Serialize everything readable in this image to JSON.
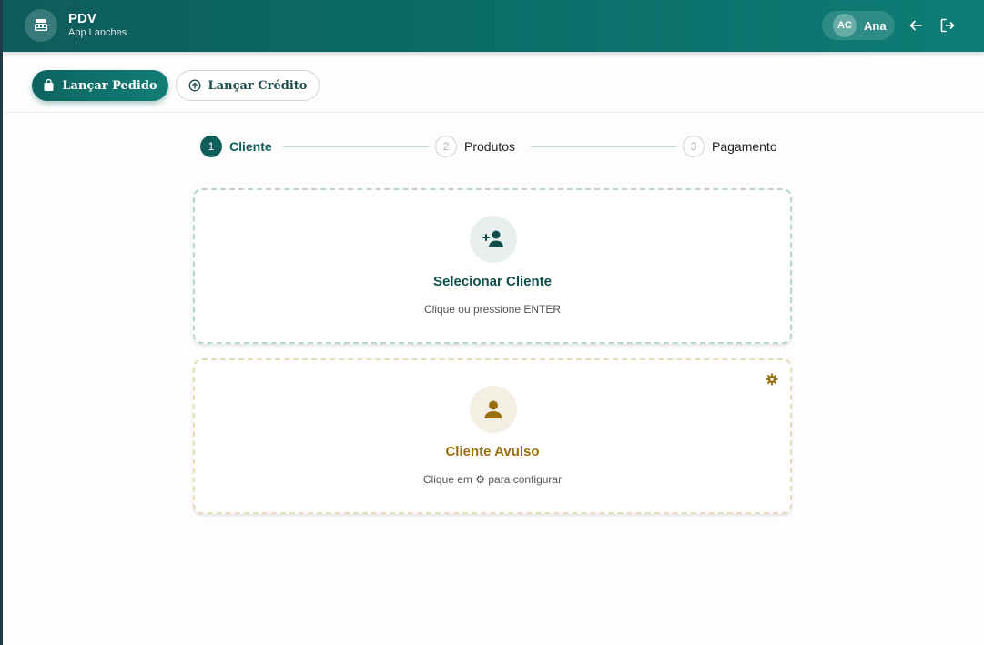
{
  "header": {
    "title": "PDV",
    "subtitle": "App Lanches",
    "user": {
      "initials": "AC",
      "name": "Ana"
    },
    "icons": {
      "logo": "cash-register-icon",
      "back": "arrow-left-icon",
      "logout": "logout-icon"
    }
  },
  "actions": {
    "primary_label": "Lançar Pedido",
    "secondary_label": "Lançar Crédito",
    "icons": {
      "primary": "shopping-bag-icon",
      "secondary": "circle-arrow-up-icon"
    }
  },
  "stepper": {
    "steps": [
      {
        "number": "1",
        "label": "Cliente",
        "active": true
      },
      {
        "number": "2",
        "label": "Produtos",
        "active": false
      },
      {
        "number": "3",
        "label": "Pagamento",
        "active": false
      }
    ]
  },
  "cards": {
    "select_client": {
      "title": "Selecionar Cliente",
      "hint": "Clique ou pressione ENTER",
      "icon": "user-plus-icon"
    },
    "walk_in_client": {
      "title": "Cliente Avulso",
      "hint_before": "Clique em",
      "hint_glyph": "⚙",
      "hint_after": "para configurar",
      "icon": "user-icon",
      "settings_icon": "gear-icon"
    }
  },
  "colors": {
    "brand": "#0b6f6a",
    "brand_dark": "#0e5e5a",
    "accent_gold": "#9a6f0f"
  }
}
